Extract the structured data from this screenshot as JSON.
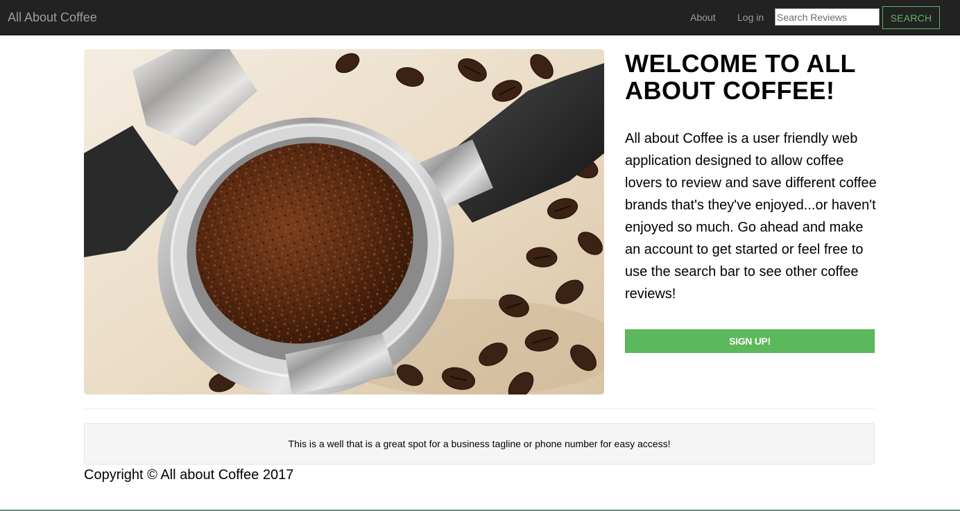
{
  "navbar": {
    "brand": "All About Coffee",
    "links": {
      "about": "About",
      "login": "Log in"
    },
    "search": {
      "placeholder": "Search Reviews",
      "value": "",
      "button_label": "SEARCH"
    }
  },
  "hero": {
    "image_icon": "coffee-portafilter-photo-icon",
    "title": "WELCOME TO ALL ABOUT COFFEE!",
    "description": "All about Coffee is a user friendly web application designed to allow coffee lovers to review and save different coffee brands that's they've enjoyed...or haven't enjoyed so much. Go ahead and make an account to get started or feel free to use the search bar to see other coffee reviews!",
    "signup_label": "SIGN UP!"
  },
  "well": {
    "text": "This is a well that is a great spot for a business tagline or phone number for easy access!"
  },
  "footer": {
    "copyright": "Copyright © All about Coffee 2017"
  },
  "colors": {
    "navbar_bg": "#222222",
    "nav_text": "#9d9d9d",
    "accent_green": "#5cb85c",
    "well_bg": "#f5f5f5"
  }
}
